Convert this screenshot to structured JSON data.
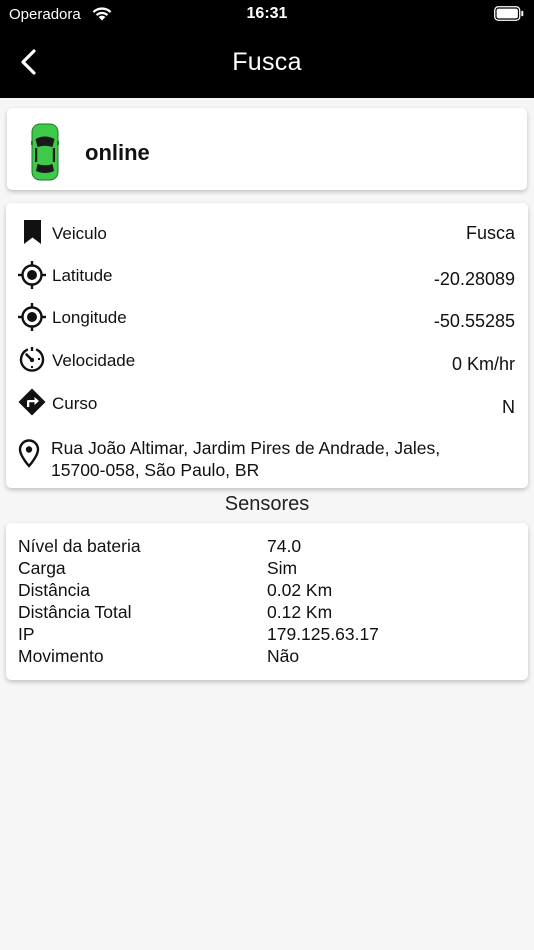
{
  "status_bar": {
    "carrier": "Operadora",
    "time": "16:31"
  },
  "nav": {
    "title": "Fusca"
  },
  "vehicle_status": {
    "state": "online",
    "car_color": "#3fc94b"
  },
  "info": {
    "vehicle_label": "Veiculo",
    "vehicle_value": "Fusca",
    "latitude_label": "Latitude",
    "latitude_value": "-20.28089",
    "longitude_label": "Longitude",
    "longitude_value": "-50.55285",
    "speed_label": "Velocidade",
    "speed_value": "0 Km/hr",
    "course_label": "Curso",
    "course_value": "N",
    "address_line1": "Rua João Altimar, Jardim Pires de Andrade, Jales,",
    "address_line2": "15700-058, São Paulo, BR"
  },
  "sensors": {
    "title": "Sensores",
    "rows": [
      {
        "key": "Nível da bateria",
        "value": "74.0"
      },
      {
        "key": "Carga",
        "value": "Sim"
      },
      {
        "key": "Distância",
        "value": "0.02 Km"
      },
      {
        "key": "Distância Total",
        "value": "0.12 Km"
      },
      {
        "key": "IP",
        "value": "179.125.63.17"
      },
      {
        "key": "Movimento",
        "value": "Não"
      }
    ]
  }
}
